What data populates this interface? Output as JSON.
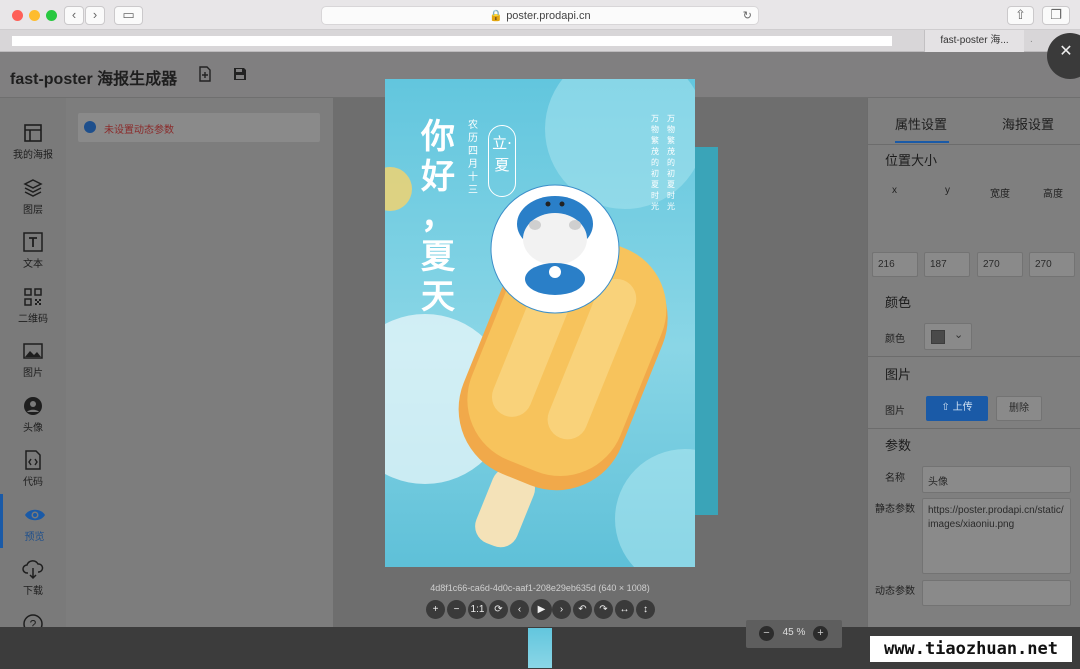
{
  "browser": {
    "url": "poster.prodapi.cn",
    "tab_title": "fast-poster 海...",
    "tab_ellipsis": "."
  },
  "header": {
    "title": "fast-poster 海报生成器"
  },
  "sidebar": {
    "items": [
      {
        "label": "我的海报",
        "icon": "poster-icon"
      },
      {
        "label": "图层",
        "icon": "layers-icon"
      },
      {
        "label": "文本",
        "icon": "text-icon"
      },
      {
        "label": "二维码",
        "icon": "qrcode-icon"
      },
      {
        "label": "图片",
        "icon": "image-icon"
      },
      {
        "label": "头像",
        "icon": "avatar-icon"
      },
      {
        "label": "代码",
        "icon": "code-icon"
      },
      {
        "label": "预览",
        "icon": "eye-icon"
      },
      {
        "label": "下载",
        "icon": "download-icon"
      },
      {
        "label": "帮助",
        "icon": "help-icon"
      }
    ],
    "active": "预览"
  },
  "left_panel": {
    "dynamic_notice": "未设置动态参数"
  },
  "right_panel": {
    "tabs": [
      "属性设置",
      "海报设置"
    ],
    "position_section": "位置大小",
    "x_label": "x",
    "y_label": "y",
    "w_label": "宽度",
    "h_label": "高度",
    "x": "216",
    "y": "187",
    "w": "270",
    "h": "270",
    "color_section": "颜色",
    "color_label": "颜色",
    "image_section": "图片",
    "image_label": "图片",
    "upload_label": "上传",
    "delete_label": "删除",
    "param_section": "参数",
    "name_label": "名称",
    "name_value": "头像",
    "static_label": "静态参数",
    "static_value": "https://poster.prodapi.cn/static/images/xiaoniu.png",
    "dynamic_label": "动态参数",
    "dynamic_value": ""
  },
  "preview": {
    "caption": "4d8f1c66-ca6d-4d0c-aaf1-208e29eb635d (640 × 1008)",
    "poster_title_1": "你",
    "poster_title_2": "好",
    "poster_title_3": "，",
    "poster_title_4": "夏",
    "poster_title_5": "天",
    "lunar_date": "农历四月十三",
    "solar_term": "立·夏",
    "verse_1": "万物繁茂的初夏时光",
    "verse_2": "万物繁茂的初夏时光",
    "controls": [
      "+",
      "−",
      "1:1",
      "⟳",
      "‹",
      "▶",
      "›",
      "↶",
      "↷",
      "↔",
      "↕"
    ],
    "zoom": "45 %",
    "zoom_minus": "−",
    "zoom_plus": "+"
  },
  "watermark": "www.tiaozhuan.net",
  "colors": {
    "accent": "#1a5aa7",
    "poster_bg": "#62c6de",
    "popsicle": "#f4b85a"
  }
}
